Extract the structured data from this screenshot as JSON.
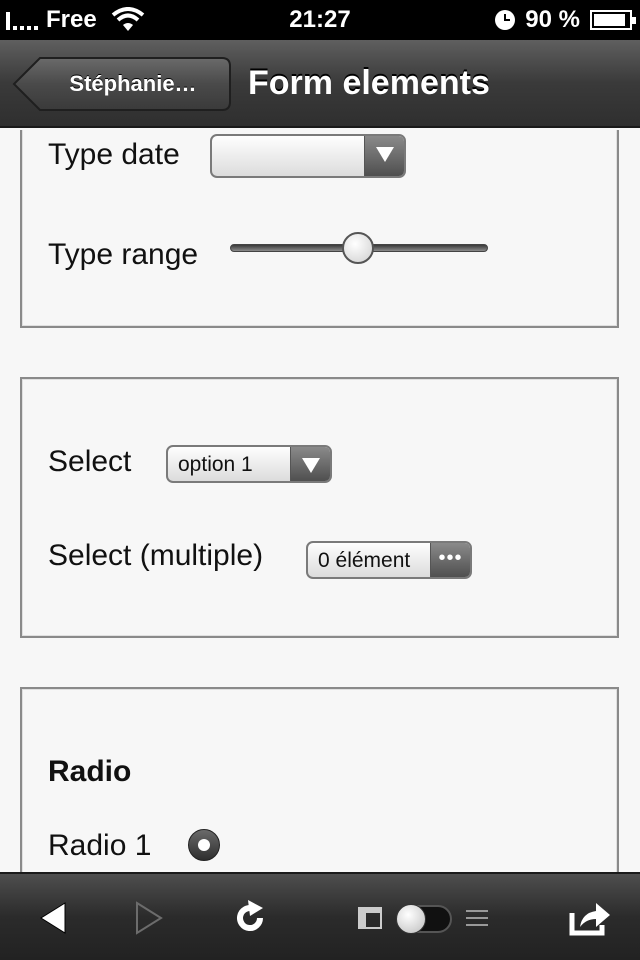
{
  "status_bar": {
    "carrier": "Free",
    "time": "21:27",
    "battery": "90 %",
    "battery_level": 0.9
  },
  "nav": {
    "back_label": "Stéphanie…",
    "title": "Form elements"
  },
  "form": {
    "date_label": "Type date",
    "date_value": "",
    "range_label": "Type range",
    "range_value": 0.5,
    "select_label": "Select",
    "select_value": "option 1",
    "multi_label": "Select (multiple)",
    "multi_value": "0 élément",
    "radio_heading": "Radio",
    "radio_1_label": "Radio 1"
  },
  "toolbar": {
    "items": [
      "back-icon",
      "forward-icon",
      "reload-icon",
      "reader-toggle",
      "share-icon"
    ]
  }
}
